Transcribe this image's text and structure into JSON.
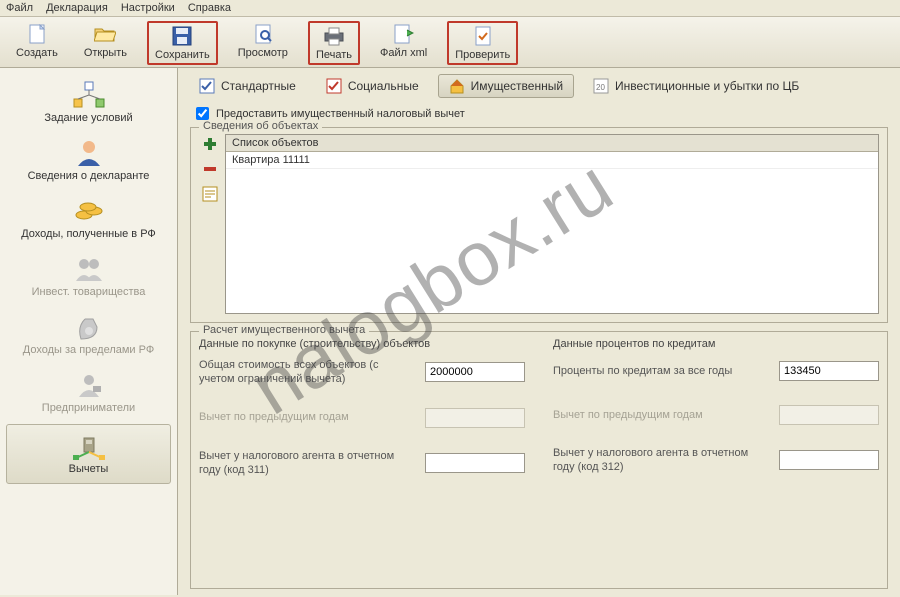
{
  "menubar": [
    "Файл",
    "Декларация",
    "Настройки",
    "Справка"
  ],
  "toolbar": [
    {
      "key": "create",
      "label": "Создать",
      "hl": false
    },
    {
      "key": "open",
      "label": "Открыть",
      "hl": false
    },
    {
      "key": "save",
      "label": "Сохранить",
      "hl": true
    },
    {
      "key": "preview",
      "label": "Просмотр",
      "hl": false
    },
    {
      "key": "print",
      "label": "Печать",
      "hl": true
    },
    {
      "key": "filexml",
      "label": "Файл xml",
      "hl": false
    },
    {
      "key": "check",
      "label": "Проверить",
      "hl": true
    }
  ],
  "sidebar": [
    {
      "key": "conditions",
      "label": "Задание условий",
      "disabled": false
    },
    {
      "key": "declarant",
      "label": "Сведения о декларанте",
      "disabled": false
    },
    {
      "key": "income-rf",
      "label": "Доходы, полученные в РФ",
      "disabled": false
    },
    {
      "key": "invest",
      "label": "Инвест. товарищества",
      "disabled": true
    },
    {
      "key": "income-abroad",
      "label": "Доходы за пределами РФ",
      "disabled": true
    },
    {
      "key": "entrepreneur",
      "label": "Предприниматели",
      "disabled": true
    },
    {
      "key": "deductions",
      "label": "Вычеты",
      "disabled": false,
      "active": true
    }
  ],
  "tabs": [
    {
      "key": "standard",
      "label": "Стандартные",
      "active": false
    },
    {
      "key": "social",
      "label": "Социальные",
      "active": false
    },
    {
      "key": "property",
      "label": "Имущественный",
      "active": true
    },
    {
      "key": "investcb",
      "label": "Инвестиционные и убытки по ЦБ",
      "active": false
    }
  ],
  "checkbox": {
    "checked": true,
    "label": "Предоставить имущественный налоговый вычет"
  },
  "objects": {
    "title": "Сведения об объектах",
    "header": "Список объектов",
    "rows": [
      "Квартира 11111"
    ]
  },
  "calc": {
    "title": "Расчет имущественного вычета",
    "left": {
      "title": "Данные по покупке (строительству) объектов",
      "f1": {
        "label": "Общая стоимость всех объектов (с учетом ограничений вычета)",
        "value": "2000000"
      },
      "f2": {
        "label": "Вычет по предыдущим годам",
        "value": ""
      },
      "f3": {
        "label": "Вычет у налогового агента в отчетном году (код 311)",
        "value": ""
      }
    },
    "right": {
      "title": "Данные процентов по кредитам",
      "f1": {
        "label": "Проценты по кредитам за все годы",
        "value": "133450"
      },
      "f2": {
        "label": "Вычет по предыдущим годам",
        "value": ""
      },
      "f3": {
        "label": "Вычет у налогового агента в отчетном году (код 312)",
        "value": ""
      }
    }
  },
  "watermark": "nalogbox.ru"
}
